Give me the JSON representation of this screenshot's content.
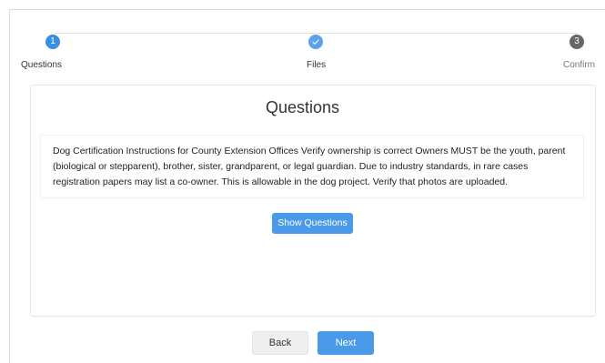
{
  "stepper": {
    "steps": [
      {
        "number": "1",
        "label": "Questions",
        "state": "active"
      },
      {
        "number": "",
        "label": "Files",
        "state": "done",
        "icon": "check-icon"
      },
      {
        "number": "3",
        "label": "Confirm",
        "state": "pending"
      }
    ]
  },
  "card": {
    "title": "Questions",
    "instructions": "Dog Certification Instructions for County Extension Offices Verify ownership is correct Owners MUST be the youth, parent (biological or stepparent), brother, sister, grandparent, or legal guardian. Due to industry standards, in rare cases registration papers may list a co-owner. This is allowable in the dog project. Verify that photos are uploaded.",
    "show_questions_label": "Show Questions"
  },
  "footer": {
    "back_label": "Back",
    "next_label": "Next"
  },
  "colors": {
    "accent": "#4a9ae9",
    "step_active": "#3a8ee6",
    "step_pending": "#666666"
  }
}
